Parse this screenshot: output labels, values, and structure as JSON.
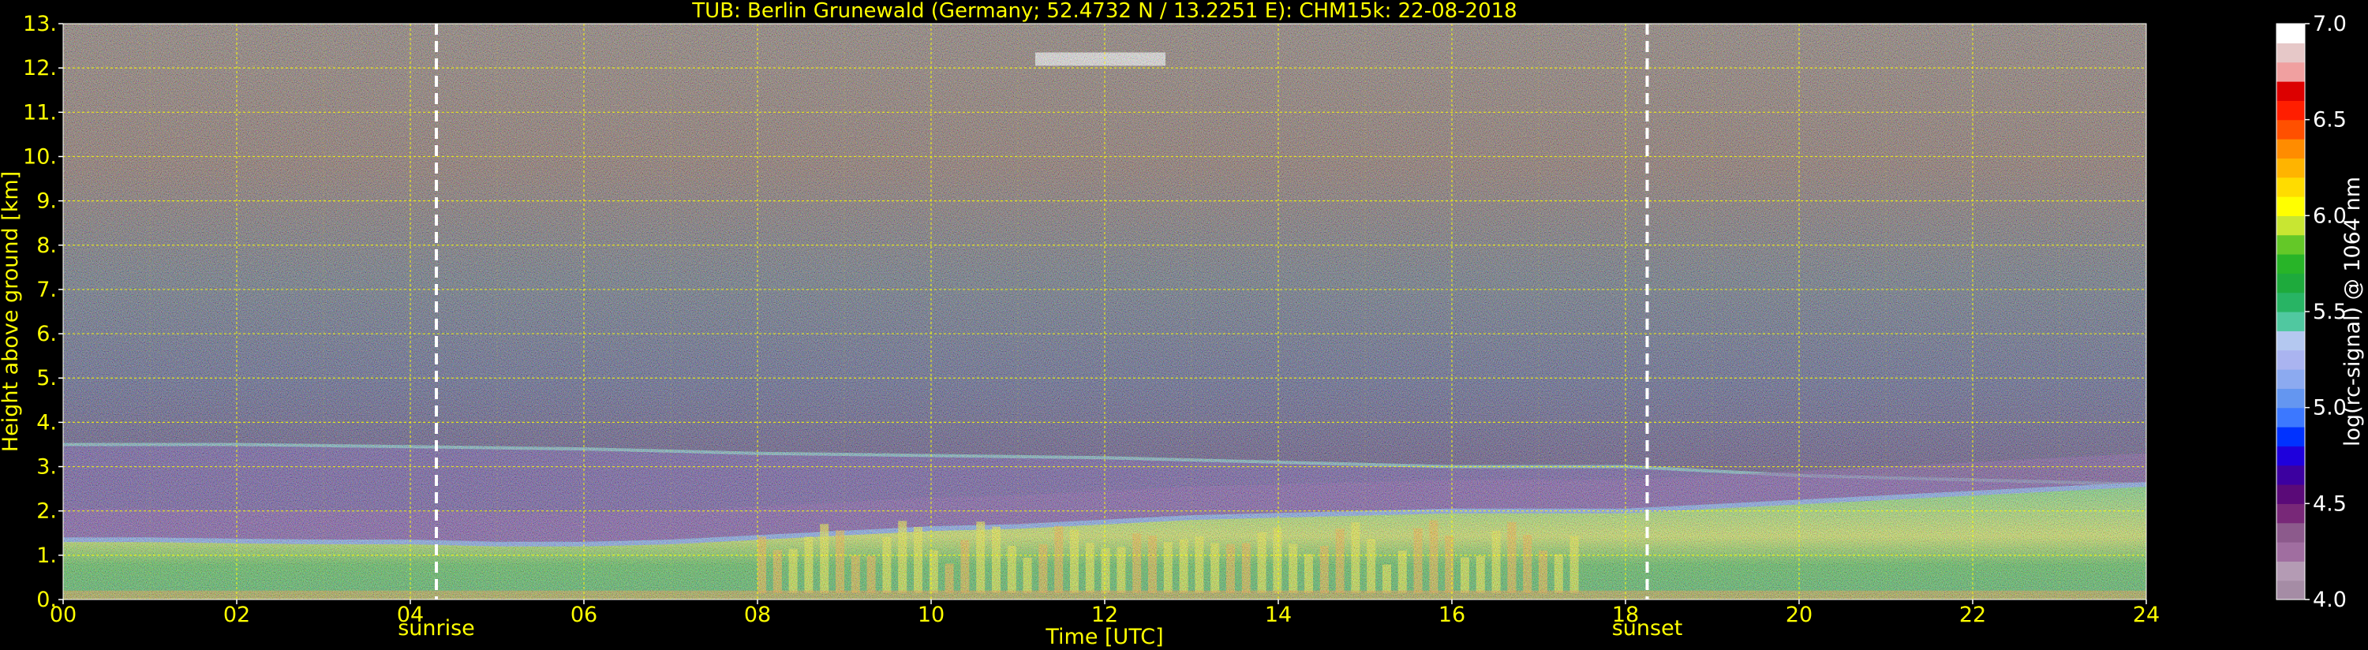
{
  "chart_data": {
    "type": "heatmap",
    "title": "TUB: Berlin Grunewald (Germany; 52.4732 N / 13.2251 E):    CHM15k: 22-08-2018",
    "xlabel": "Time [UTC]",
    "ylabel": "Height above ground [km]",
    "xlim": [
      0,
      24
    ],
    "ylim": [
      0,
      13
    ],
    "x_ticks": [
      "00",
      "02",
      "04",
      "06",
      "08",
      "10",
      "12",
      "14",
      "16",
      "18",
      "20",
      "22",
      "24"
    ],
    "y_ticks": [
      "0.",
      "1.",
      "2.",
      "3.",
      "4.",
      "5.",
      "6.",
      "7.",
      "8.",
      "9.",
      "10.",
      "11.",
      "12.",
      "13."
    ],
    "grid": true,
    "vertical_lines": [
      {
        "label": "sunrise",
        "x": 4.3
      },
      {
        "label": "sunset",
        "x": 18.25
      }
    ],
    "colorbar": {
      "label": "log(rc-signal) @ 1064 nm",
      "range": [
        4.0,
        7.0
      ],
      "ticks": [
        "4.0",
        "4.5",
        "5.0",
        "5.5",
        "6.0",
        "6.5",
        "7.0"
      ],
      "colors": [
        "#a58ca5",
        "#b49bb4",
        "#a06ea0",
        "#8c5a8c",
        "#782878",
        "#5a0a78",
        "#3c00a0",
        "#1e00dc",
        "#0032ff",
        "#3c78ff",
        "#6496f0",
        "#8caaf0",
        "#aab4f0",
        "#b4c8f0",
        "#50c8a0",
        "#28b464",
        "#1eaa3c",
        "#28b428",
        "#64c828",
        "#c8e632",
        "#ffff00",
        "#ffdc00",
        "#ffb400",
        "#ff8c00",
        "#ff5000",
        "#ff1e00",
        "#dc0000",
        "#f0a0a0",
        "#e6c8c8",
        "#ffffff"
      ]
    },
    "features": {
      "boundary_layer_top_km": [
        [
          0,
          1.35
        ],
        [
          1,
          1.35
        ],
        [
          2,
          1.32
        ],
        [
          3,
          1.3
        ],
        [
          4,
          1.3
        ],
        [
          5,
          1.25
        ],
        [
          6,
          1.25
        ],
        [
          7,
          1.3
        ],
        [
          8,
          1.4
        ],
        [
          9,
          1.5
        ],
        [
          10,
          1.6
        ],
        [
          11,
          1.65
        ],
        [
          12,
          1.75
        ],
        [
          13,
          1.85
        ],
        [
          14,
          1.9
        ],
        [
          15,
          1.95
        ],
        [
          16,
          2.0
        ],
        [
          17,
          2.0
        ],
        [
          18,
          2.0
        ],
        [
          19,
          2.1
        ],
        [
          20,
          2.2
        ],
        [
          21,
          2.3
        ],
        [
          22,
          2.4
        ],
        [
          23,
          2.5
        ],
        [
          24,
          2.6
        ]
      ],
      "residual_layer_top_km": [
        [
          0,
          3.5
        ],
        [
          2,
          3.5
        ],
        [
          4,
          3.45
        ],
        [
          6,
          3.4
        ],
        [
          8,
          3.3
        ],
        [
          10,
          3.25
        ],
        [
          12,
          3.2
        ],
        [
          14,
          3.1
        ],
        [
          16,
          3.0
        ],
        [
          18,
          3.0
        ],
        [
          19,
          2.9
        ],
        [
          20,
          2.8
        ],
        [
          22,
          2.7
        ],
        [
          24,
          2.6
        ]
      ],
      "cirrus_patches_km": [
        {
          "x_start": 11.2,
          "x_end": 12.7,
          "height": 12.2
        }
      ]
    }
  }
}
